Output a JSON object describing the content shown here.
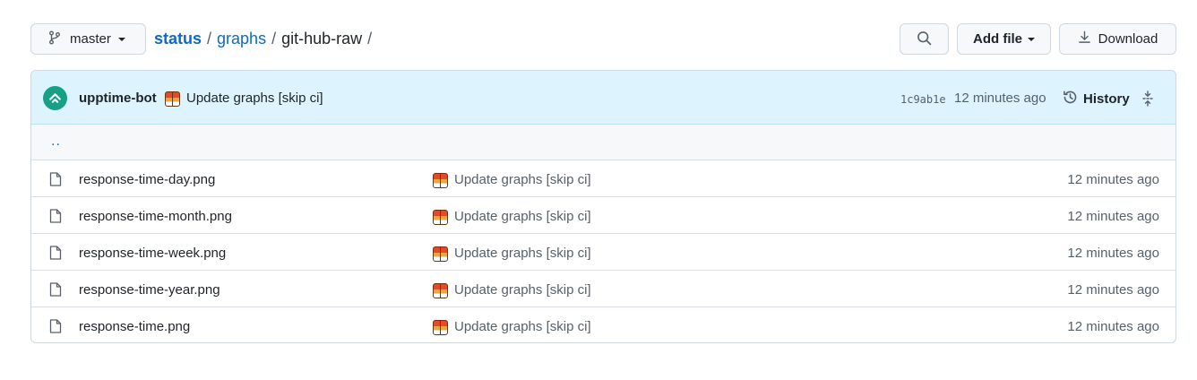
{
  "toolbar": {
    "branch": "master",
    "breadcrumb": [
      {
        "label": "status"
      },
      {
        "label": "graphs"
      },
      {
        "label": "git-hub-raw"
      }
    ],
    "separator": "/",
    "add_file_label": "Add file",
    "download_label": "Download"
  },
  "commit": {
    "author": "upptime-bot",
    "message": "Update graphs [skip ci]",
    "sha": "1c9ab1e",
    "time": "12 minutes ago",
    "history_label": "History"
  },
  "parent_link": "..",
  "files": [
    {
      "name": "response-time-day.png",
      "message": "Update graphs [skip ci]",
      "time": "12 minutes ago"
    },
    {
      "name": "response-time-month.png",
      "message": "Update graphs [skip ci]",
      "time": "12 minutes ago"
    },
    {
      "name": "response-time-week.png",
      "message": "Update graphs [skip ci]",
      "time": "12 minutes ago"
    },
    {
      "name": "response-time-year.png",
      "message": "Update graphs [skip ci]",
      "time": "12 minutes ago"
    },
    {
      "name": "response-time.png",
      "message": "Update graphs [skip ci]",
      "time": "12 minutes ago"
    }
  ],
  "colors": {
    "link": "#0969da",
    "commit_bar_bg": "#ddf4ff",
    "avatar": "#16a085",
    "border": "#d0d7de"
  },
  "icons": {
    "branch": "git-branch-icon",
    "search": "search-icon",
    "download": "download-icon",
    "history": "history-icon",
    "expand": "unfold-icon",
    "file": "file-icon",
    "emoji": "bar-chart-emoji"
  }
}
